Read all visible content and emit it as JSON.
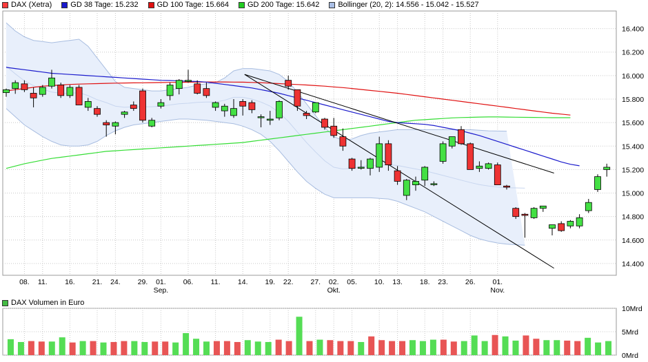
{
  "legend": {
    "items": [
      {
        "label": "DAX (Xetra)",
        "color": "#ff3b3b"
      },
      {
        "label": "GD 38 Tage: 15.232",
        "color": "#1a1acc"
      },
      {
        "label": "GD 100 Tage: 15.664",
        "color": "#e01010"
      },
      {
        "label": "GD 200 Tage: 15.642",
        "color": "#22cc22"
      },
      {
        "label": "Bollinger (20, 2): 14.556 - 15.042 - 15.527",
        "color": "#aabfe6"
      }
    ],
    "volume_label": "DAX Volumen in Euro",
    "volume_color": "#44bb44"
  },
  "colors": {
    "up": "#44e044",
    "down": "#ee3333",
    "ma38": "#1a1acc",
    "ma100": "#e01010",
    "ma200": "#33dd33",
    "boll_fill": "#e8effb",
    "boll_line": "#a8bde0",
    "grid": "#c8c8c8",
    "vol_up": "#55dd55",
    "vol_down": "#e85555"
  },
  "chart_data": [
    {
      "type": "candlestick",
      "title": "DAX (Xetra)",
      "y_ticks": [
        "14.400",
        "14.600",
        "14.800",
        "15.000",
        "15.200",
        "15.400",
        "15.600",
        "15.800",
        "16.000",
        "16.200",
        "16.400"
      ],
      "ylim": [
        14300,
        16550
      ],
      "x_tick_labels": [
        "08.",
        "11.",
        "16.",
        "21.",
        "24.",
        "29.",
        "01.",
        "06.",
        "11.",
        "14.",
        "19.",
        "22.",
        "27.",
        "02.",
        "05.",
        "10.",
        "13.",
        "18.",
        "23.",
        "26.",
        "01."
      ],
      "x_tick_index": [
        2,
        4,
        7,
        10,
        12,
        15,
        17,
        20,
        23,
        26,
        29,
        31,
        34,
        36,
        38,
        41,
        43,
        46,
        48,
        51,
        54
      ],
      "month_labels": [
        {
          "label": "Sep.",
          "index": 17
        },
        {
          "label": "Okt.",
          "index": 36
        },
        {
          "label": "Nov.",
          "index": 54
        }
      ],
      "candles": [
        {
          "o": 15855,
          "h": 15890,
          "l": 15820,
          "c": 15880
        },
        {
          "o": 15890,
          "h": 15960,
          "l": 15845,
          "c": 15940
        },
        {
          "o": 15930,
          "h": 15960,
          "l": 15860,
          "c": 15880
        },
        {
          "o": 15850,
          "h": 15900,
          "l": 15730,
          "c": 15810
        },
        {
          "o": 15840,
          "h": 15920,
          "l": 15820,
          "c": 15900
        },
        {
          "o": 15910,
          "h": 16050,
          "l": 15890,
          "c": 15980
        },
        {
          "o": 15920,
          "h": 15940,
          "l": 15810,
          "c": 15830
        },
        {
          "o": 15830,
          "h": 15920,
          "l": 15810,
          "c": 15900
        },
        {
          "o": 15900,
          "h": 15920,
          "l": 15760,
          "c": 15750
        },
        {
          "o": 15730,
          "h": 15810,
          "l": 15700,
          "c": 15780
        },
        {
          "o": 15720,
          "h": 15740,
          "l": 15650,
          "c": 15670
        },
        {
          "o": 15600,
          "h": 15620,
          "l": 15480,
          "c": 15580
        },
        {
          "o": 15570,
          "h": 15610,
          "l": 15500,
          "c": 15600
        },
        {
          "o": 15670,
          "h": 15700,
          "l": 15640,
          "c": 15690
        },
        {
          "o": 15750,
          "h": 15780,
          "l": 15700,
          "c": 15720
        },
        {
          "o": 15870,
          "h": 15890,
          "l": 15600,
          "c": 15620
        },
        {
          "o": 15570,
          "h": 15640,
          "l": 15560,
          "c": 15620
        },
        {
          "o": 15740,
          "h": 15800,
          "l": 15720,
          "c": 15770
        },
        {
          "o": 15830,
          "h": 15940,
          "l": 15790,
          "c": 15920
        },
        {
          "o": 15890,
          "h": 15970,
          "l": 15840,
          "c": 15960
        },
        {
          "o": 15950,
          "h": 16050,
          "l": 15940,
          "c": 15960
        },
        {
          "o": 15930,
          "h": 15960,
          "l": 15840,
          "c": 15850
        },
        {
          "o": 15890,
          "h": 15940,
          "l": 15810,
          "c": 15830
        },
        {
          "o": 15730,
          "h": 15780,
          "l": 15700,
          "c": 15770
        },
        {
          "o": 15700,
          "h": 15760,
          "l": 15650,
          "c": 15740
        },
        {
          "o": 15660,
          "h": 15800,
          "l": 15640,
          "c": 15720
        },
        {
          "o": 15780,
          "h": 15800,
          "l": 15660,
          "c": 15740
        },
        {
          "o": 15770,
          "h": 15790,
          "l": 15680,
          "c": 15710
        },
        {
          "o": 15650,
          "h": 15670,
          "l": 15560,
          "c": 15650
        },
        {
          "o": 15620,
          "h": 15700,
          "l": 15580,
          "c": 15630
        },
        {
          "o": 15640,
          "h": 15790,
          "l": 15620,
          "c": 15780
        },
        {
          "o": 15960,
          "h": 16000,
          "l": 15880,
          "c": 15910
        },
        {
          "o": 15880,
          "h": 15880,
          "l": 15700,
          "c": 15740
        },
        {
          "o": 15680,
          "h": 15700,
          "l": 15630,
          "c": 15660
        },
        {
          "o": 15690,
          "h": 15760,
          "l": 15680,
          "c": 15770
        },
        {
          "o": 15630,
          "h": 15640,
          "l": 15540,
          "c": 15560
        },
        {
          "o": 15570,
          "h": 15640,
          "l": 15470,
          "c": 15490
        },
        {
          "o": 15480,
          "h": 15550,
          "l": 15360,
          "c": 15400
        },
        {
          "o": 15290,
          "h": 15300,
          "l": 15190,
          "c": 15210
        },
        {
          "o": 15220,
          "h": 15280,
          "l": 15200,
          "c": 15220
        },
        {
          "o": 15210,
          "h": 15300,
          "l": 15150,
          "c": 15290
        },
        {
          "o": 15220,
          "h": 15480,
          "l": 15180,
          "c": 15420
        },
        {
          "o": 15420,
          "h": 15450,
          "l": 15190,
          "c": 15240
        },
        {
          "o": 15190,
          "h": 15230,
          "l": 15070,
          "c": 15100
        },
        {
          "o": 14980,
          "h": 15120,
          "l": 14940,
          "c": 15110
        },
        {
          "o": 15070,
          "h": 15140,
          "l": 15020,
          "c": 15100
        },
        {
          "o": 15110,
          "h": 15230,
          "l": 15060,
          "c": 15220
        },
        {
          "o": 15080,
          "h": 15100,
          "l": 15060,
          "c": 15080
        },
        {
          "o": 15270,
          "h": 15440,
          "l": 15250,
          "c": 15420
        },
        {
          "o": 15400,
          "h": 15470,
          "l": 15380,
          "c": 15480
        },
        {
          "o": 15540,
          "h": 15570,
          "l": 15410,
          "c": 15420
        },
        {
          "o": 15420,
          "h": 15430,
          "l": 15200,
          "c": 15200
        },
        {
          "o": 15210,
          "h": 15270,
          "l": 15180,
          "c": 15230
        },
        {
          "o": 15210,
          "h": 15260,
          "l": 15200,
          "c": 15250
        },
        {
          "o": 15240,
          "h": 15260,
          "l": 15080,
          "c": 15070
        },
        {
          "o": 15060,
          "h": 15070,
          "l": 15030,
          "c": 15050
        },
        {
          "o": 14870,
          "h": 14880,
          "l": 14780,
          "c": 14800
        },
        {
          "o": 14820,
          "h": 14830,
          "l": 14620,
          "c": 14810
        },
        {
          "o": 14790,
          "h": 14880,
          "l": 14780,
          "c": 14870
        },
        {
          "o": 14870,
          "h": 14890,
          "l": 14840,
          "c": 14890
        },
        {
          "o": 14700,
          "h": 14720,
          "l": 14640,
          "c": 14730
        },
        {
          "o": 14740,
          "h": 14760,
          "l": 14670,
          "c": 14680
        },
        {
          "o": 14720,
          "h": 14770,
          "l": 14700,
          "c": 14760
        },
        {
          "o": 14720,
          "h": 14820,
          "l": 14700,
          "c": 14790
        },
        {
          "o": 14850,
          "h": 14950,
          "l": 14830,
          "c": 14920
        },
        {
          "o": 15030,
          "h": 15160,
          "l": 15010,
          "c": 15140
        },
        {
          "o": 15200,
          "h": 15250,
          "l": 15140,
          "c": 15220
        }
      ],
      "gd38": [
        16070,
        16060,
        16050,
        16040,
        16030,
        16020,
        16015,
        16010,
        16005,
        16000,
        15995,
        15990,
        15985,
        15980,
        15975,
        15970,
        15965,
        15960,
        15958,
        15955,
        15952,
        15950,
        15945,
        15935,
        15925,
        15915,
        15905,
        15895,
        15880,
        15865,
        15850,
        15830,
        15810,
        15790,
        15770,
        15750,
        15730,
        15710,
        15690,
        15670,
        15650,
        15630,
        15610,
        15600,
        15595,
        15590,
        15585,
        15575,
        15560,
        15545,
        15530,
        15510,
        15490,
        15465,
        15440,
        15415,
        15390,
        15365,
        15340,
        15315,
        15290,
        15265,
        15245,
        15232
      ],
      "gd100": [
        15870,
        15880,
        15890,
        15900,
        15910,
        15915,
        15920,
        15925,
        15928,
        15930,
        15932,
        15934,
        15936,
        15937,
        15938,
        15939,
        15940,
        15941,
        15942,
        15943,
        15944,
        15945,
        15946,
        15946,
        15946,
        15945,
        15944,
        15942,
        15940,
        15936,
        15932,
        15928,
        15924,
        15920,
        15915,
        15910,
        15904,
        15898,
        15890,
        15882,
        15874,
        15866,
        15858,
        15850,
        15840,
        15830,
        15820,
        15810,
        15800,
        15790,
        15780,
        15770,
        15760,
        15750,
        15740,
        15730,
        15720,
        15710,
        15700,
        15690,
        15680,
        15672,
        15664
      ],
      "gd200": [
        15210,
        15230,
        15250,
        15265,
        15280,
        15295,
        15305,
        15315,
        15325,
        15335,
        15345,
        15355,
        15360,
        15365,
        15370,
        15375,
        15380,
        15385,
        15390,
        15395,
        15400,
        15405,
        15410,
        15415,
        15420,
        15425,
        15430,
        15440,
        15450,
        15460,
        15470,
        15480,
        15490,
        15500,
        15510,
        15520,
        15530,
        15540,
        15550,
        15560,
        15570,
        15580,
        15590,
        15600,
        15610,
        15620,
        15625,
        15630,
        15635,
        15640,
        15643,
        15645,
        15647,
        15648,
        15648,
        15647,
        15646,
        15645,
        15644,
        15643,
        15642,
        15642,
        15642
      ],
      "boll_upper": [
        16450,
        16380,
        16330,
        16300,
        16290,
        16280,
        16290,
        16300,
        16310,
        16250,
        16150,
        16050,
        15950,
        15900,
        15890,
        15880,
        15870,
        15870,
        15880,
        15890,
        15900,
        15920,
        15930,
        15940,
        15980,
        16040,
        16060,
        16060,
        16050,
        16040,
        16010,
        15950,
        15860,
        15760,
        15660,
        15560,
        15480,
        15450,
        15460,
        15490,
        15510,
        15520,
        15530,
        15540,
        15540,
        15540,
        15540,
        15540,
        15540,
        15540,
        15540,
        15540,
        15535,
        15530,
        15528,
        15527
      ],
      "boll_lower": [
        15720,
        15650,
        15580,
        15530,
        15480,
        15440,
        15410,
        15400,
        15400,
        15410,
        15440,
        15490,
        15530,
        15560,
        15580,
        15590,
        15600,
        15610,
        15620,
        15630,
        15630,
        15625,
        15620,
        15610,
        15600,
        15590,
        15570,
        15540,
        15500,
        15440,
        15360,
        15270,
        15180,
        15100,
        15040,
        14990,
        14960,
        14960,
        14960,
        14960,
        14960,
        14955,
        14950,
        14930,
        14900,
        14870,
        14840,
        14800,
        14760,
        14720,
        14680,
        14640,
        14610,
        14590,
        14575,
        14565,
        14560,
        14556
      ],
      "boll_mid": [
        16080,
        16015,
        15955,
        15915,
        15885,
        15860,
        15850,
        15850,
        15855,
        15830,
        15795,
        15770,
        15740,
        15730,
        15735,
        15735,
        15735,
        15740,
        15750,
        15760,
        15765,
        15772,
        15775,
        15775,
        15790,
        15815,
        15815,
        15800,
        15775,
        15740,
        15685,
        15610,
        15520,
        15430,
        15350,
        15275,
        15220,
        15205,
        15210,
        15225,
        15235,
        15237,
        15240,
        15235,
        15220,
        15205,
        15190,
        15170,
        15150,
        15130,
        15110,
        15090,
        15072,
        15060,
        15051,
        15046,
        15044,
        15042
      ],
      "trendlines": [
        {
          "from": {
            "i": 26.2,
            "v": 16010
          },
          "to": {
            "i": 60.2,
            "v": 14360
          }
        },
        {
          "from": {
            "i": 26.2,
            "v": 16010
          },
          "to": {
            "i": 60.2,
            "v": 15170
          }
        }
      ]
    },
    {
      "type": "bar",
      "title": "DAX Volumen in Euro",
      "y_ticks": [
        "10Mrd",
        "5Mrd",
        "0Mrd"
      ],
      "ylim": [
        0,
        10
      ],
      "values": [
        3.4,
        2.8,
        3.0,
        2.9,
        2.9,
        3.8,
        2.7,
        3.0,
        3.0,
        2.7,
        2.8,
        3.0,
        3.0,
        2.8,
        2.9,
        2.9,
        2.7,
        4.7,
        3.5,
        2.9,
        3.0,
        3.0,
        2.8,
        3.2,
        2.9,
        2.8,
        3.3,
        3.0,
        8.2,
        3.0,
        3.3,
        3.2,
        3.0,
        3.0,
        2.8,
        4.0,
        3.2,
        3.0,
        3.0,
        3.2,
        3.0,
        3.3,
        3.3,
        2.9,
        3.0,
        4.2,
        3.0,
        4.3,
        4.0,
        3.1,
        4.2,
        3.5,
        3.2,
        3.2,
        3.1,
        3.0,
        3.7,
        2.7,
        3.0
      ],
      "up": [
        1,
        1,
        0,
        0,
        1,
        1,
        0,
        1,
        0,
        1,
        0,
        0,
        1,
        1,
        0,
        0,
        1,
        1,
        1,
        1,
        0,
        0,
        0,
        1,
        1,
        1,
        0,
        0,
        1,
        0,
        1,
        0,
        0,
        0,
        1,
        0,
        0,
        0,
        0,
        1,
        1,
        1,
        0,
        0,
        1,
        1,
        1,
        0,
        1,
        1,
        0,
        0,
        1,
        1,
        0,
        0,
        1,
        1,
        1
      ]
    }
  ]
}
